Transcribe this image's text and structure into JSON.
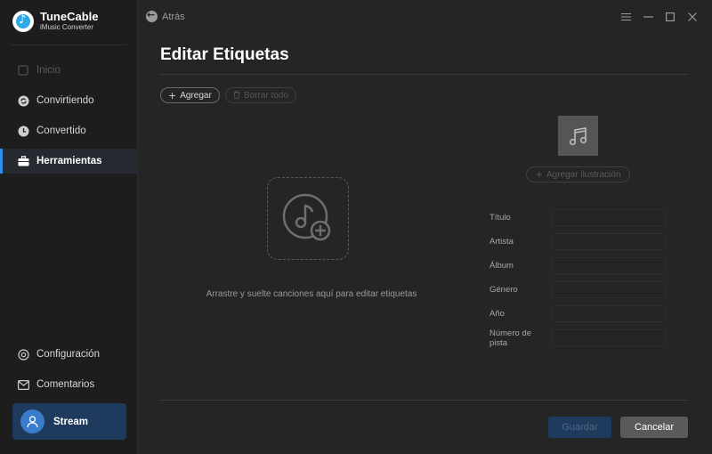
{
  "app": {
    "name": "TuneCable",
    "subtitle": "iMusic Converter"
  },
  "sidebar": {
    "items": [
      {
        "label": "Inicio"
      },
      {
        "label": "Convirtiendo"
      },
      {
        "label": "Convertido"
      },
      {
        "label": "Herramientas"
      }
    ],
    "bottom_items": [
      {
        "label": "Configuración"
      },
      {
        "label": "Comentarios"
      }
    ],
    "stream": {
      "label": "Stream"
    }
  },
  "titlebar": {
    "back_label": "Atrás"
  },
  "main": {
    "title": "Editar Etiquetas",
    "add_label": "Agregar",
    "clear_label": "Borrar todo",
    "drop_hint": "Arrastre y suelte canciones aquí para editar etiquetas",
    "add_artwork_label": "Agregar ilustración",
    "fields": [
      {
        "label": "Título",
        "value": ""
      },
      {
        "label": "Artista",
        "value": ""
      },
      {
        "label": "Álbum",
        "value": ""
      },
      {
        "label": "Género",
        "value": ""
      },
      {
        "label": "Año",
        "value": ""
      },
      {
        "label": "Número de pista",
        "value": ""
      }
    ],
    "save_label": "Guardar",
    "cancel_label": "Cancelar"
  },
  "colors": {
    "accent": "#2f8fea",
    "background": "#252525",
    "sidebar": "#1d1d1d",
    "stream_card": "#1e3a5c"
  },
  "icons": {
    "menu": "hamburger-icon",
    "minimize": "minimize-icon",
    "maximize": "maximize-icon",
    "close": "close-icon"
  }
}
